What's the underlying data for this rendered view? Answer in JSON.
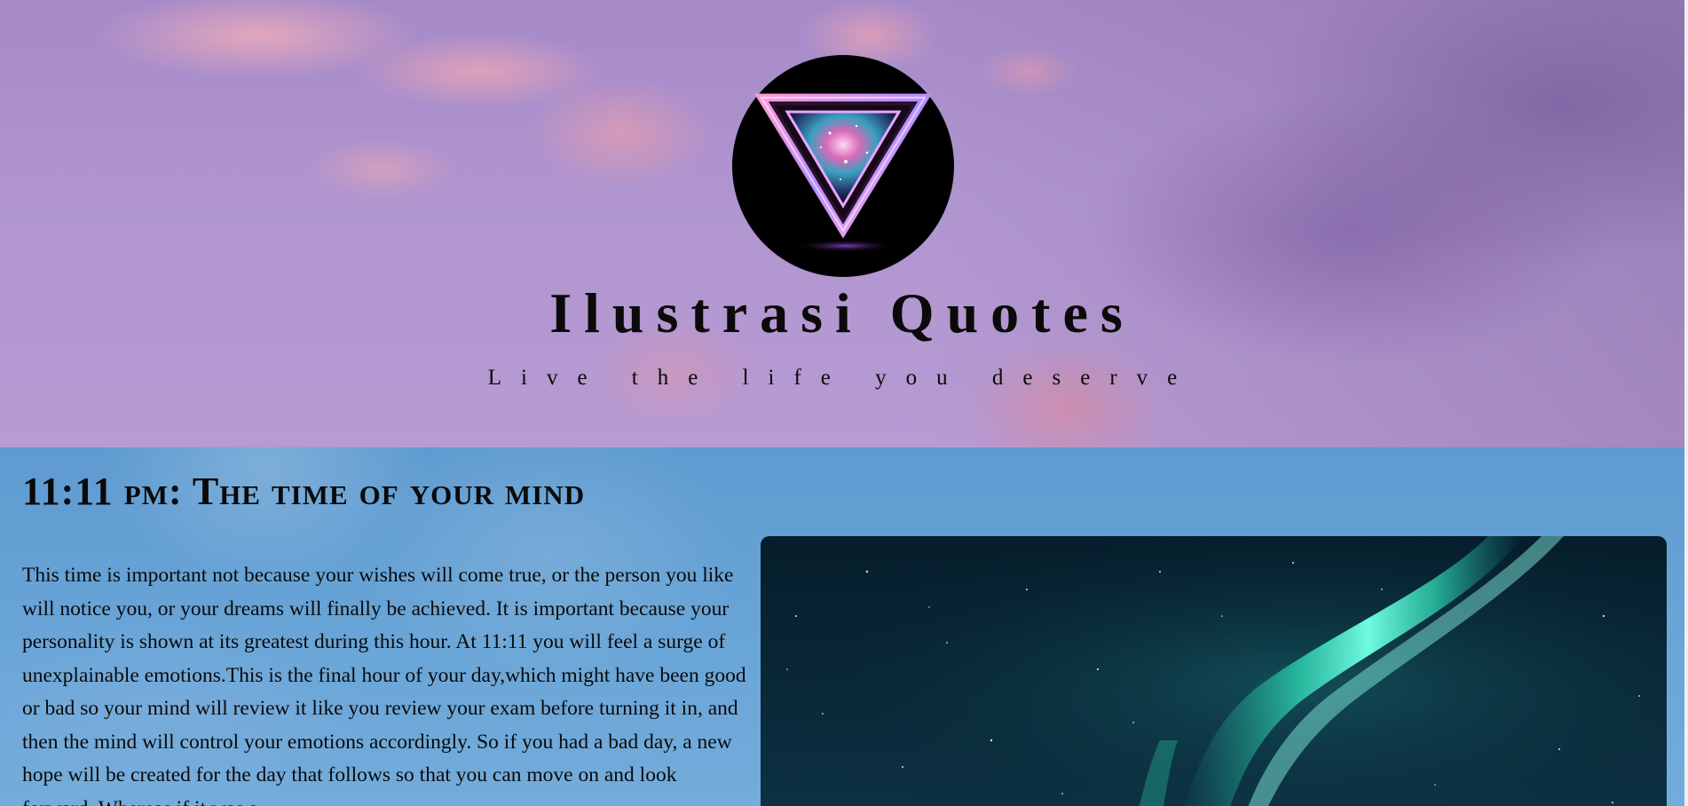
{
  "header": {
    "title": "Ilustrasi Quotes",
    "tagline": "Live the life you deserve"
  },
  "icons": {
    "logo": "inverted-galaxy-triangle-logo"
  },
  "article": {
    "title": "11:11 pm: The time of your mind",
    "body": "This time is important not because your wishes will come true, or the person you like will notice you, or your dreams will finally be achieved. It is important because your personality is shown at its greatest during this hour. At 11:11 you will feel a surge of unexplainable emotions.This is the final hour of your day,which might have been good or bad so your mind will review it like you review your exam before turning it in, and then the mind will control your emotions accordingly. So if you had a bad day, a new hope will be created for the day that follows so that you can move on and look forward. Whereas if it was a"
  },
  "colors": {
    "header_sky": "#b095cf",
    "content_sky": "#6aa6d8",
    "aurora_green": "#3ff0c8",
    "logo_background": "#000000"
  }
}
